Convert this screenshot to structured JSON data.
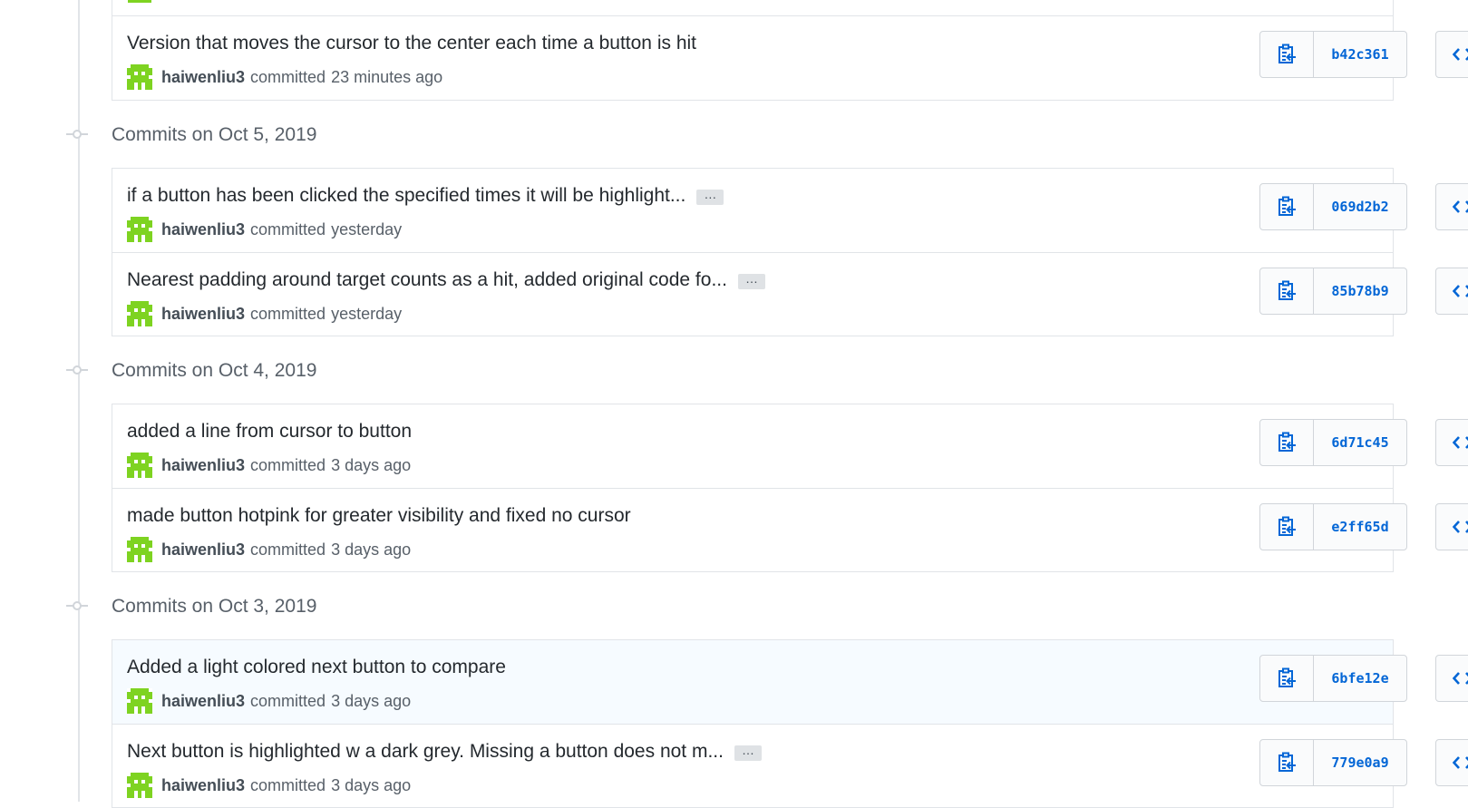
{
  "avatar_color": "#7ed321",
  "link_color": "#0366d6",
  "icons": {
    "copy": "clipboard-copy-icon",
    "browse": "code-brackets-icon"
  },
  "groups": [
    {
      "date_label": "",
      "commits": [
        {
          "message": "Version that moves the cursor to the center each time a button is hit",
          "truncated": false,
          "author": "haiwenliu3",
          "action": "committed",
          "time": "23 minutes ago",
          "sha": "b42c361",
          "highlighted": false
        }
      ]
    },
    {
      "date_label": "Commits on Oct 5, 2019",
      "commits": [
        {
          "message": "if a button has been clicked the specified times it will be highlight...",
          "truncated": true,
          "author": "haiwenliu3",
          "action": "committed",
          "time": "yesterday",
          "sha": "069d2b2",
          "highlighted": false
        },
        {
          "message": "Nearest padding around target counts as a hit, added original code fo...",
          "truncated": true,
          "author": "haiwenliu3",
          "action": "committed",
          "time": "yesterday",
          "sha": "85b78b9",
          "highlighted": false
        }
      ]
    },
    {
      "date_label": "Commits on Oct 4, 2019",
      "commits": [
        {
          "message": "added a line from cursor to button",
          "truncated": false,
          "author": "haiwenliu3",
          "action": "committed",
          "time": "3 days ago",
          "sha": "6d71c45",
          "highlighted": false
        },
        {
          "message": "made button hotpink for greater visibility and fixed no cursor",
          "truncated": false,
          "author": "haiwenliu3",
          "action": "committed",
          "time": "3 days ago",
          "sha": "e2ff65d",
          "highlighted": false
        }
      ]
    },
    {
      "date_label": "Commits on Oct 3, 2019",
      "commits": [
        {
          "message": "Added a light colored next button to compare",
          "truncated": false,
          "author": "haiwenliu3",
          "action": "committed",
          "time": "3 days ago",
          "sha": "6bfe12e",
          "highlighted": true
        },
        {
          "message": "Next button is highlighted w a dark grey. Missing a button does not m...",
          "truncated": true,
          "author": "haiwenliu3",
          "action": "committed",
          "time": "3 days ago",
          "sha": "779e0a9",
          "highlighted": false
        }
      ]
    }
  ],
  "ellipsis_label": "…"
}
